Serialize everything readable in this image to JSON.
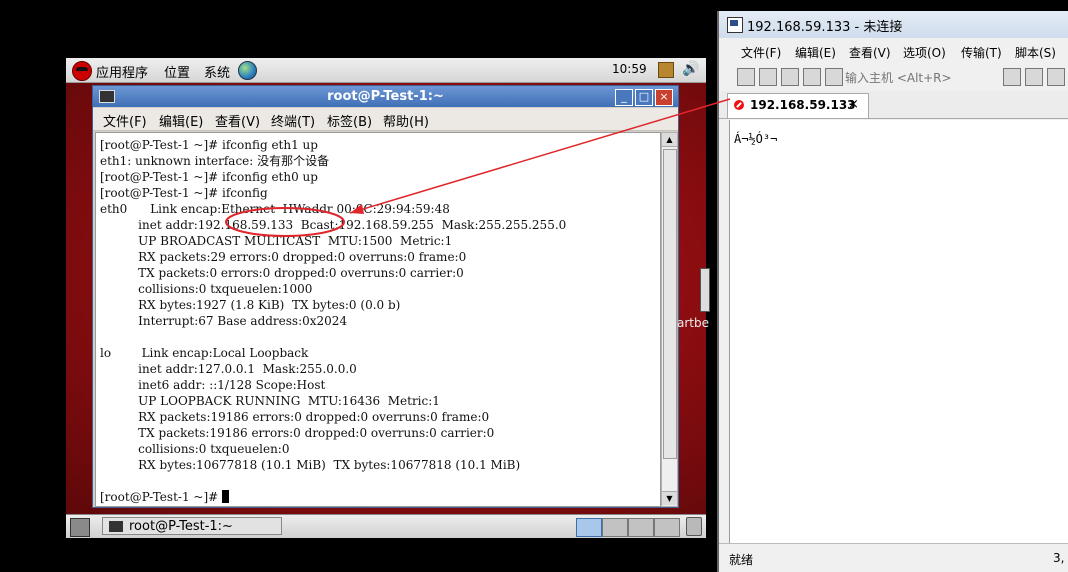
{
  "vm": {
    "panel": {
      "menu_apps": "应用程序",
      "menu_places": "位置",
      "menu_system": "系统",
      "clock": "10:59"
    },
    "terminal": {
      "title": "root@P-Test-1:~",
      "menus": [
        "文件(F)",
        "编辑(E)",
        "查看(V)",
        "终端(T)",
        "标签(B)",
        "帮助(H)"
      ],
      "lines": [
        "[root@P-Test-1 ~]# ifconfig eth1 up",
        "eth1: unknown interface: 没有那个设备",
        "[root@P-Test-1 ~]# ifconfig eth0 up",
        "[root@P-Test-1 ~]# ifconfig",
        "eth0      Link encap:Ethernet  HWaddr 00:0C:29:94:59:48",
        "          inet addr:192.168.59.133  Bcast:192.168.59.255  Mask:255.255.255.0",
        "          UP BROADCAST MULTICAST  MTU:1500  Metric:1",
        "          RX packets:29 errors:0 dropped:0 overruns:0 frame:0",
        "          TX packets:0 errors:0 dropped:0 overruns:0 carrier:0",
        "          collisions:0 txqueuelen:1000",
        "          RX bytes:1927 (1.8 KiB)  TX bytes:0 (0.0 b)",
        "          Interrupt:67 Base address:0x2024",
        "",
        "lo        Link encap:Local Loopback",
        "          inet addr:127.0.0.1  Mask:255.0.0.0",
        "          inet6 addr: ::1/128 Scope:Host",
        "          UP LOOPBACK RUNNING  MTU:16436  Metric:1",
        "          RX packets:19186 errors:0 dropped:0 overruns:0 frame:0",
        "          TX packets:19186 errors:0 dropped:0 overruns:0 carrier:0",
        "          collisions:0 txqueuelen:0",
        "          RX bytes:10677818 (10.1 MiB)  TX bytes:10677818 (10.1 MiB)",
        ""
      ],
      "prompt": "[root@P-Test-1 ~]# "
    },
    "taskbar": {
      "task_label": "root@P-Test-1:~"
    },
    "edge_text": "artbe"
  },
  "crt": {
    "title": "192.168.59.133 - 未连接",
    "menus": [
      "文件(F)",
      "编辑(E)",
      "查看(V)",
      "选项(O)",
      "传输(T)",
      "脚本(S)"
    ],
    "connect_placeholder": "输入主机 <Alt+R>",
    "tab_label": "192.168.59.133",
    "tab_close": "×",
    "session_text": "Á¬½Ó³¬",
    "status_left": "就绪",
    "status_right": "3,"
  },
  "annotation_color": "#e0262b"
}
